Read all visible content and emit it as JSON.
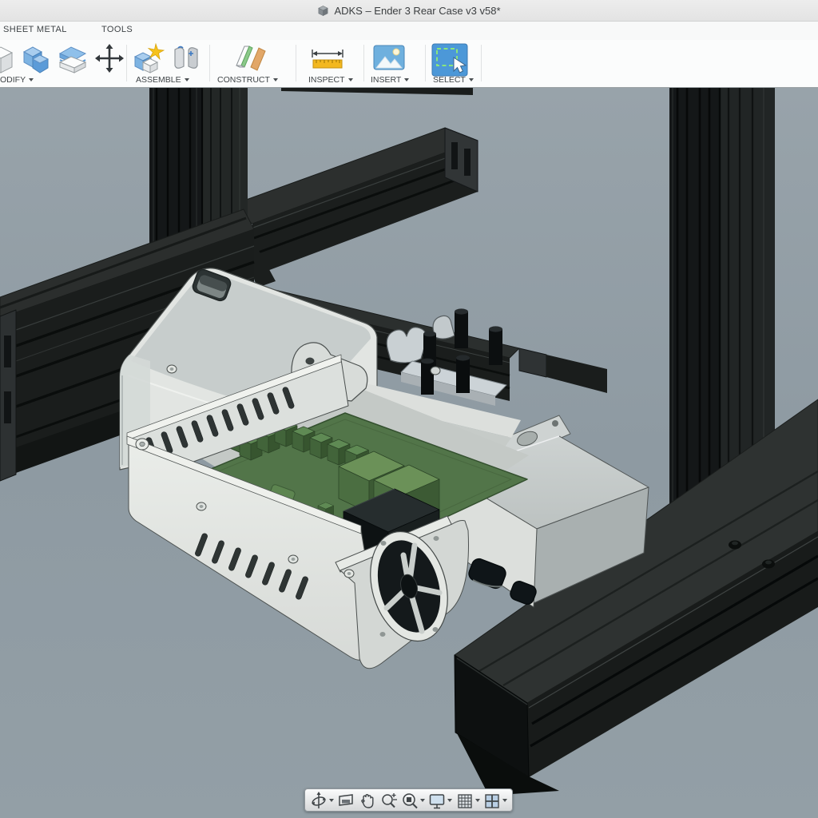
{
  "titlebar": {
    "title": "ADKS – Ender 3 Rear Case v3 v58*",
    "icon": "document-cube-icon"
  },
  "ribbon": {
    "tabs": [
      {
        "label": "SHEET METAL"
      },
      {
        "label": "TOOLS"
      }
    ],
    "groups": [
      {
        "label": "ODIFY",
        "icons": [
          "press-pull-cube-icon",
          "combine-bodies-icon",
          "offset-face-icon",
          "move-icon"
        ]
      },
      {
        "label": "ASSEMBLE",
        "icons": [
          "new-component-icon",
          "joint-icon"
        ]
      },
      {
        "label": "CONSTRUCT",
        "icons": [
          "construction-plane-icon"
        ]
      },
      {
        "label": "INSPECT",
        "icons": [
          "measure-icon"
        ]
      },
      {
        "label": "INSERT",
        "icons": [
          "insert-image-icon"
        ]
      },
      {
        "label": "SELECT",
        "icons": [
          "select-icon"
        ]
      }
    ]
  },
  "viewport": {
    "model_name": "Ender 3 rear electronics case on aluminum extrusion frame",
    "parts": [
      "aluminum-extrusion-frame",
      "printed-rear-case",
      "motherboard-pcb",
      "cooling-fan",
      "power-plug",
      "mounting-standoffs"
    ],
    "colors": {
      "background": "#909ca4",
      "extrusion_dark": "#15181a",
      "extrusion_face": "#23272a",
      "case_white": "#e7eae6",
      "case_top": "#c8cecd",
      "pcb_green": "#527549",
      "component_green": "#5f8a54",
      "fan_dark": "#14191b"
    }
  },
  "navbar": {
    "buttons": [
      {
        "id": "orbit",
        "icon": "orbit-icon",
        "has_caret": true
      },
      {
        "id": "look-at",
        "icon": "look-at-icon",
        "has_caret": false
      },
      {
        "id": "pan",
        "icon": "pan-hand-icon",
        "has_caret": false
      },
      {
        "id": "zoom",
        "icon": "zoom-icon",
        "has_caret": false
      },
      {
        "id": "fit",
        "icon": "fit-icon",
        "has_caret": true
      },
      {
        "id": "display-settings",
        "icon": "display-settings-icon",
        "has_caret": true
      },
      {
        "id": "grid",
        "icon": "grid-icon",
        "has_caret": true
      },
      {
        "id": "viewports",
        "icon": "viewports-icon",
        "has_caret": true
      }
    ]
  }
}
